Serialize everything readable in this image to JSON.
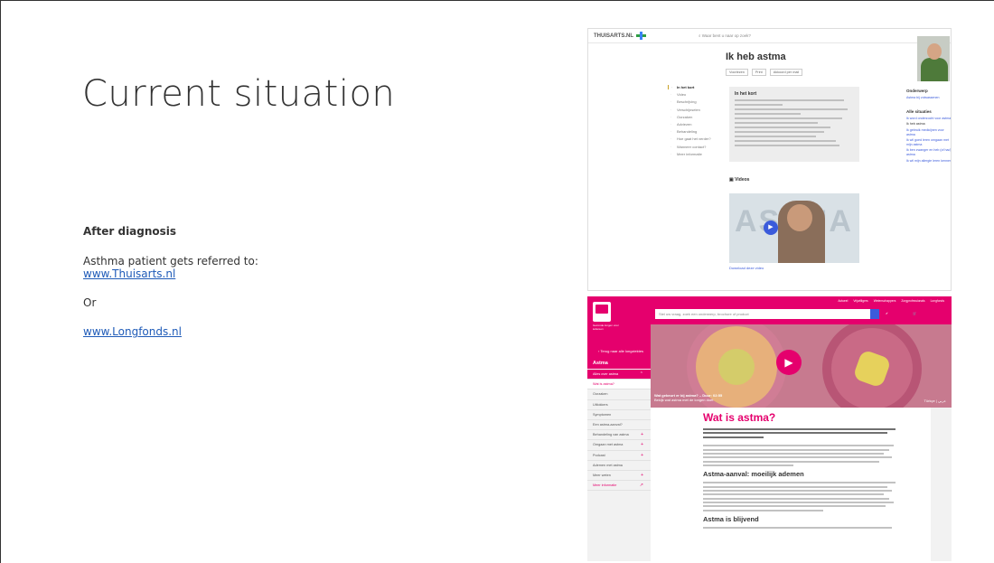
{
  "slide": {
    "title": "Current situation",
    "subheading": "After diagnosis",
    "intro": "Asthma patient gets referred to:",
    "link1": "www.Thuisarts.nl",
    "or": "Or",
    "link2": "www.Longfonds.nl"
  },
  "thuisarts": {
    "logo": "THUISARTS.NL",
    "search_placeholder": "Waar bent u naar op zoek?",
    "page_title": "Ik heb astma",
    "actions": [
      "Voorlezen",
      "Print",
      "Akkoord per mail"
    ],
    "nav": [
      "In het kort",
      "Video",
      "Beschrijving",
      "Verschijnselen",
      "Oorzaken",
      "Adviezen",
      "Behandeling",
      "Hoe gaat het verder?",
      "Wanneer contact?",
      "Meer informatie"
    ],
    "box_title": "In het kort",
    "videos_title": "Videos",
    "video_word": "ASTMA",
    "download": "Download deze video",
    "side_heading1": "Onderwerp",
    "side_link1": "Astma bij volwassenen",
    "side_heading2": "Alle situaties",
    "side_links": [
      "Ik word onderzocht voor astma",
      "Ik heb astma",
      "Ik gebruik medicijnen voor astma",
      "Ik wil goed leren omgaan met mijn astma",
      "Ik ben zwanger en heb (of had) astma",
      "Ik wil mijn allergie leren kennen"
    ]
  },
  "longfonds": {
    "top_links": [
      "Actueel",
      "Vrijwilligers",
      "Wetenschappers",
      "Zorgprofessionals",
      "Longfonds"
    ],
    "search_placeholder": "Stel uw vraag, zoek een onderwerp, brochure of product",
    "tagline": "Gezonde longen voor iedereen",
    "back": "Terug naar alle longziektes",
    "section": "Astma",
    "menu": [
      "Alles over astma",
      "Wat is astma?",
      "Oorzaken",
      "Uitlokkers",
      "Symptomen",
      "Een astma-aanval?",
      "Behandeling van astma",
      "Omgaan met astma",
      "Podcast",
      "Ademen met astma",
      "Meer weten",
      "Meer informatie"
    ],
    "hero_caption_title": "Wat gebeurt er bij astma? – Duur: 02:55",
    "hero_caption_sub": "Bekijk wat astma met de longen doet",
    "hero_lang": "Türkçe | عربي",
    "main_title": "Wat is astma?",
    "h2a": "Astma-aanval: moeilijk ademen",
    "h2b": "Astma is blijvend"
  }
}
